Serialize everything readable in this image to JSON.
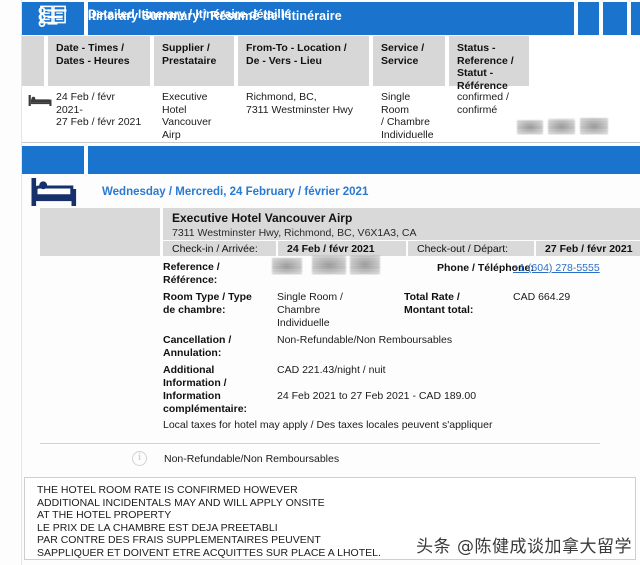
{
  "theme": {
    "header_blue": "#1a73cd",
    "link_blue": "#2a6fc9",
    "day_blue": "#2a7ad2",
    "cell_gray": "#d7d7d7"
  },
  "summary": {
    "header_title": "Itinerary Summary / Résumé de l'itinéraire",
    "icon": "bulleted-list-icon",
    "columns": [
      "",
      "Date - Times / Dates - Heures",
      "Supplier / Prestataire",
      "From-To - Location / De - Vers - Lieu",
      "Service / Service",
      "Status - Reference / Statut - Référence"
    ],
    "row": {
      "icon": "bed-icon",
      "date": "24 Feb / févr 2021-27 Feb / févr 2021",
      "date_line1": "24 Feb / févr 2021-",
      "date_line2": "27 Feb / févr 2021",
      "supplier_line1": "Executive Hotel",
      "supplier_line2": "Vancouver Airp",
      "location_line1": "Richmond, BC,",
      "location_line2": "7311 Westminster Hwy",
      "service_line1": "Single Room",
      "service_line2": "/ Chambre",
      "service_line3": "Individuelle",
      "status_line1": "confirmed /",
      "status_line2": "confirmé",
      "reference_redacted": true
    }
  },
  "detailed": {
    "header_title": "Detailed Itinerary / Itinéraire détaillé",
    "icon": "open-book-icon",
    "day_icon": "bed-icon",
    "day_label": "Wednesday / Mercredi, 24 February / février 2021",
    "hotel": {
      "name": "Executive Hotel Vancouver Airp",
      "address": "7311 Westminster Hwy, Richmond, BC, V6X1A3, CA",
      "checkin_label": "Check-in / Arrivée:",
      "checkin_value": "24 Feb / févr 2021",
      "checkout_label": "Check-out / Départ:",
      "checkout_value": "27 Feb / févr 2021",
      "reference_label_line1": "Reference /",
      "reference_label_line2": "Référence:",
      "reference_value_redacted": true,
      "phone_label": "Phone / Téléphone:",
      "phone_value": "+1 (604) 278-5555",
      "roomtype_label_line1": "Room Type / Type",
      "roomtype_label_line2": "de chambre:",
      "roomtype_value_line1": "Single Room /",
      "roomtype_value_line2": "Chambre",
      "roomtype_value_line3": "Individuelle",
      "totalrate_label_line1": "Total Rate /",
      "totalrate_label_line2": "Montant total:",
      "totalrate_value": "CAD 664.29",
      "cancellation_label_line1": "Cancellation /",
      "cancellation_label_line2": "Annulation:",
      "cancellation_value": "Non-Refundable/Non Remboursables",
      "additional_label_line1": "Additional",
      "additional_label_line2": "Information /",
      "additional_label_line3": "Information",
      "additional_label_line4": "complémentaire:",
      "additional_value_line1": "CAD 221.43/night / nuit",
      "additional_value_line2": "24 Feb 2021 to 27 Feb 2021 - CAD 189.00",
      "local_taxes": "Local taxes for hotel may apply / Des taxes locales peuvent s'appliquer"
    },
    "footer_note": {
      "icon": "info-circle-icon",
      "text": "Non-Refundable/Non Remboursables"
    }
  },
  "notice": {
    "lines": [
      "THE HOTEL ROOM RATE IS CONFIRMED HOWEVER",
      "ADDITIONAL INCIDENTALS MAY AND WILL APPLY ONSITE",
      "AT THE HOTEL PROPERTY",
      "LE PRIX DE LA CHAMBRE EST DEJA PREETABLI",
      "PAR CONTRE DES FRAIS SUPPLEMENTAIRES PEUVENT",
      "SAPPLIQUER ET DOIVENT ETRE ACQUITTES SUR PLACE A LHOTEL."
    ]
  },
  "watermark": "头条 @陈健成谈加拿大留学"
}
